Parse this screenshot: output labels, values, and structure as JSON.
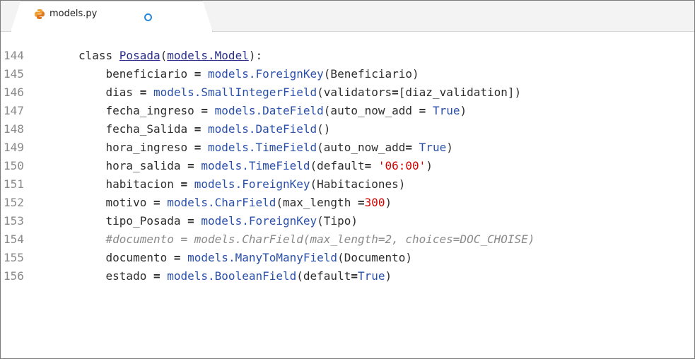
{
  "tab": {
    "title": "models.py",
    "modified": true,
    "icon": "python-file-icon"
  },
  "colors": {
    "keyword": "#2d2d2d",
    "builtin_ref": "#2a4fa8",
    "literal": "#d40000",
    "comment": "#8a8a8a",
    "modified_dot": "#2b8ad8"
  },
  "lines": [
    {
      "num": "144",
      "indent": "",
      "t1": "class ",
      "t2": "Posada",
      "t3": "(",
      "t4": "models.Model",
      "t5": "):"
    },
    {
      "num": "145",
      "indent": "    ",
      "field": "beneficiario",
      "eq": " = ",
      "call": "models.ForeignKey",
      "args": "(Beneficiario)"
    },
    {
      "num": "146",
      "indent": "    ",
      "field": "dias",
      "eq": " = ",
      "call": "models.SmallIntegerField",
      "args_a": "(validators",
      "args_b": "=",
      "args_c": "[diaz_validation])"
    },
    {
      "num": "147",
      "indent": "    ",
      "field": "fecha_ingreso",
      "eq": " = ",
      "call": "models.DateField",
      "args_a": "(auto_now_add ",
      "args_b": "=",
      "args_c": " ",
      "lit": "True",
      "args_d": ")"
    },
    {
      "num": "148",
      "indent": "    ",
      "field": "fecha_Salida",
      "eq": " = ",
      "call": "models.DateField",
      "args": "()"
    },
    {
      "num": "149",
      "indent": "    ",
      "field": "hora_ingreso",
      "eq": " = ",
      "call": "models.TimeField",
      "args_a": "(auto_now_add",
      "args_b": "=",
      "args_c": " ",
      "lit": "True",
      "args_d": ")"
    },
    {
      "num": "150",
      "indent": "    ",
      "field": "hora_salida",
      "eq": " = ",
      "call": "models.TimeField",
      "args_a": "(default",
      "args_b": "=",
      "args_c": " ",
      "lit": "'06:00'",
      "args_d": ")"
    },
    {
      "num": "151",
      "indent": "    ",
      "field": "habitacion",
      "eq": " = ",
      "call": "models.ForeignKey",
      "args": "(Habitaciones)"
    },
    {
      "num": "152",
      "indent": "    ",
      "field": "motivo",
      "eq": " = ",
      "call": "models.CharField",
      "args_a": "(max_length ",
      "args_b": "=",
      "lit": "300",
      "args_d": ")"
    },
    {
      "num": "153",
      "indent": "    ",
      "field": "tipo_Posada",
      "eq": " = ",
      "call": "models.ForeignKey",
      "args": "(Tipo)"
    },
    {
      "num": "154",
      "indent": "    ",
      "comment": "#documento = models.CharField(max_length=2, choices=DOC_CHOISE)"
    },
    {
      "num": "155",
      "indent": "    ",
      "field": "documento",
      "eq": " = ",
      "call": "models.ManyToManyField",
      "args": "(Documento)"
    },
    {
      "num": "156",
      "indent": "    ",
      "field": "estado",
      "eq": " = ",
      "call": "models.BooleanField",
      "args_a": "(default",
      "args_b": "=",
      "lit": "True",
      "args_d": ")"
    }
  ]
}
